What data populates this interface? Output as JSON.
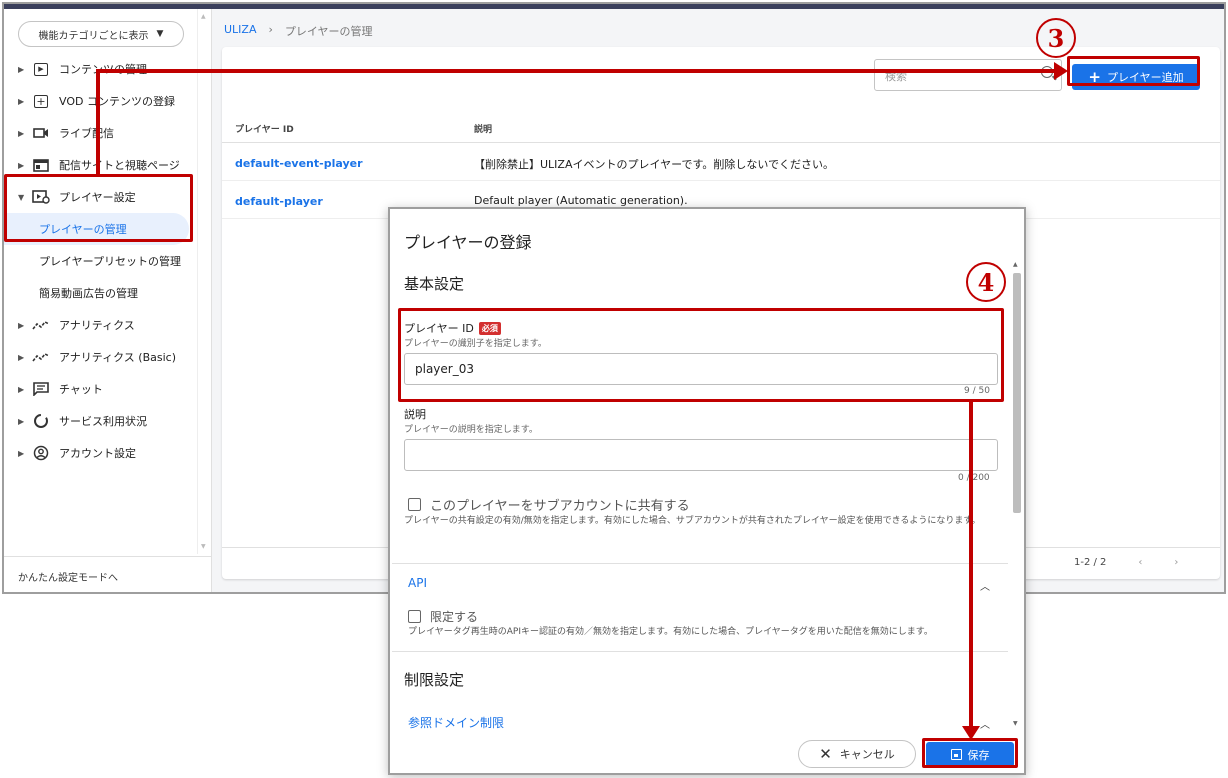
{
  "sidebar": {
    "category_select": "機能カテゴリごとに表示",
    "items": [
      {
        "label": "コンテンツの管理",
        "icon": "play-box-icon"
      },
      {
        "label": "VOD コンテンツの登録",
        "icon": "add-box-icon"
      },
      {
        "label": "ライブ配信",
        "icon": "video-camera-icon"
      },
      {
        "label": "配信サイトと視聴ページ",
        "icon": "web-page-icon"
      },
      {
        "label": "プレイヤー設定",
        "icon": "player-settings-icon",
        "expanded": true
      }
    ],
    "sub_items": [
      "プレイヤーの管理",
      "プレイヤープリセットの管理",
      "簡易動画広告の管理"
    ],
    "items_after": [
      {
        "label": "アナリティクス",
        "icon": "analytics-icon"
      },
      {
        "label": "アナリティクス (Basic)",
        "icon": "analytics-icon"
      },
      {
        "label": "チャット",
        "icon": "chat-icon"
      },
      {
        "label": "サービス利用状況",
        "icon": "usage-circle-icon"
      },
      {
        "label": "アカウント設定",
        "icon": "account-icon"
      }
    ],
    "footer": "かんたん設定モードへ"
  },
  "breadcrumb": {
    "home": "ULIZA",
    "separator": "›",
    "current": "プレイヤーの管理"
  },
  "toolbar": {
    "search_placeholder": "検索",
    "add_button": "プレイヤー追加"
  },
  "table": {
    "headers": [
      "プレイヤー ID",
      "説明"
    ],
    "rows": [
      {
        "id": "default-event-player",
        "desc": "【削除禁止】ULIZAイベントのプレイヤーです。削除しないでください。"
      },
      {
        "id": "default-player",
        "desc": "Default player (Automatic generation)."
      }
    ],
    "pager": "1-2 / 2"
  },
  "dialog": {
    "title": "プレイヤーの登録",
    "basic_section": "基本設定",
    "player_id": {
      "label": "プレイヤー ID",
      "required": "必須",
      "help": "プレイヤーの識別子を指定します。",
      "value": "player_03",
      "counter": "9 / 50"
    },
    "description": {
      "label": "説明",
      "help": "プレイヤーの説明を指定します。",
      "value": "",
      "counter": "0 / 200"
    },
    "share": {
      "label": "このプレイヤーをサブアカウントに共有する",
      "help": "プレイヤーの共有設定の有効/無効を指定します。有効にした場合、サブアカウントが共有されたプレイヤー設定を使用できるようになります。"
    },
    "api": {
      "title": "API",
      "checkbox": "限定する",
      "help": "プレイヤータグ再生時のAPIキー認証の有効／無効を指定します。有効にした場合、プレイヤータグを用いた配信を無効にします。"
    },
    "restriction_section": "制限設定",
    "domain_restriction": "参照ドメイン制限",
    "cancel": "キャンセル",
    "save": "保存"
  },
  "annotations": {
    "step3": "3",
    "step4": "4",
    "color": "#c00000"
  }
}
